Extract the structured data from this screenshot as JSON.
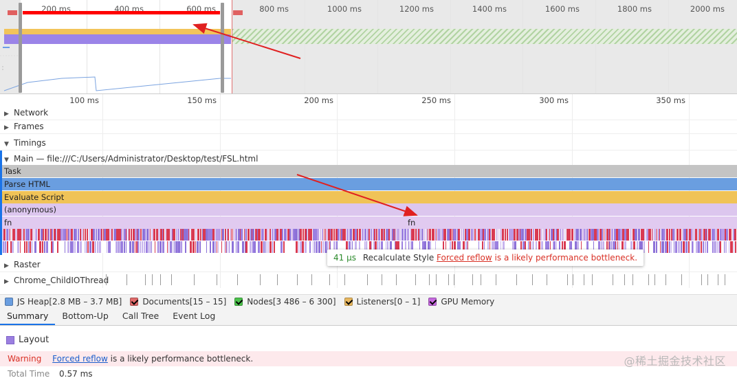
{
  "overview": {
    "ticks": [
      "200 ms",
      "400 ms",
      "600 ms",
      "800 ms",
      "1000 ms",
      "1200 ms",
      "1400 ms",
      "1600 ms",
      "1800 ms",
      "2000 ms"
    ]
  },
  "ruler": {
    "ticks": [
      "100 ms",
      "150 ms",
      "200 ms",
      "250 ms",
      "300 ms",
      "350 ms"
    ]
  },
  "tracks": {
    "network": "Network",
    "frames": "Frames",
    "timings": "Timings",
    "main": "Main — file:///C:/Users/Administrator/Desktop/test/FSL.html",
    "raster": "Raster",
    "io_thread": "Chrome_ChildIOThread"
  },
  "flame": {
    "task": "Task",
    "parse_html": "Parse HTML",
    "evaluate_script": "Evaluate Script",
    "anonymous": "(anonymous)",
    "fn_left": "fn",
    "fn_right": "fn",
    "colors": {
      "task": "#c4c4c4",
      "parse_html": "#6a9ee0",
      "evaluate_script": "#f0c357",
      "anonymous": "#dcc6ee",
      "fn": "#e1caf0",
      "layout": "#9b7fe0",
      "style": "#8d72d8",
      "forced": "#d93a52"
    }
  },
  "tooltip": {
    "duration": "41 µs",
    "event": "Recalculate Style",
    "link": "Forced reflow",
    "tail": "is a likely performance bottleneck."
  },
  "counters": [
    {
      "label": "JS Heap[2.8 MB – 3.7 MB]",
      "color": "#6a9ee0",
      "checked": false
    },
    {
      "label": "Documents[15 – 15]",
      "color": "#e06a6a",
      "checked": true
    },
    {
      "label": "Nodes[3 486 – 6 300]",
      "color": "#4cc24c",
      "checked": true
    },
    {
      "label": "Listeners[0 – 1]",
      "color": "#e8b860",
      "checked": true
    },
    {
      "label": "GPU Memory",
      "color": "#c66adf",
      "checked": true
    }
  ],
  "tabs": [
    "Summary",
    "Bottom-Up",
    "Call Tree",
    "Event Log"
  ],
  "summary": {
    "title": "Layout",
    "warning_label": "Warning",
    "warning_link": "Forced reflow",
    "warning_tail": "is a likely performance bottleneck.",
    "total_time_label": "Total Time",
    "total_time_value": "0.57 ms",
    "watermark": "@稀土掘金技术社区"
  }
}
